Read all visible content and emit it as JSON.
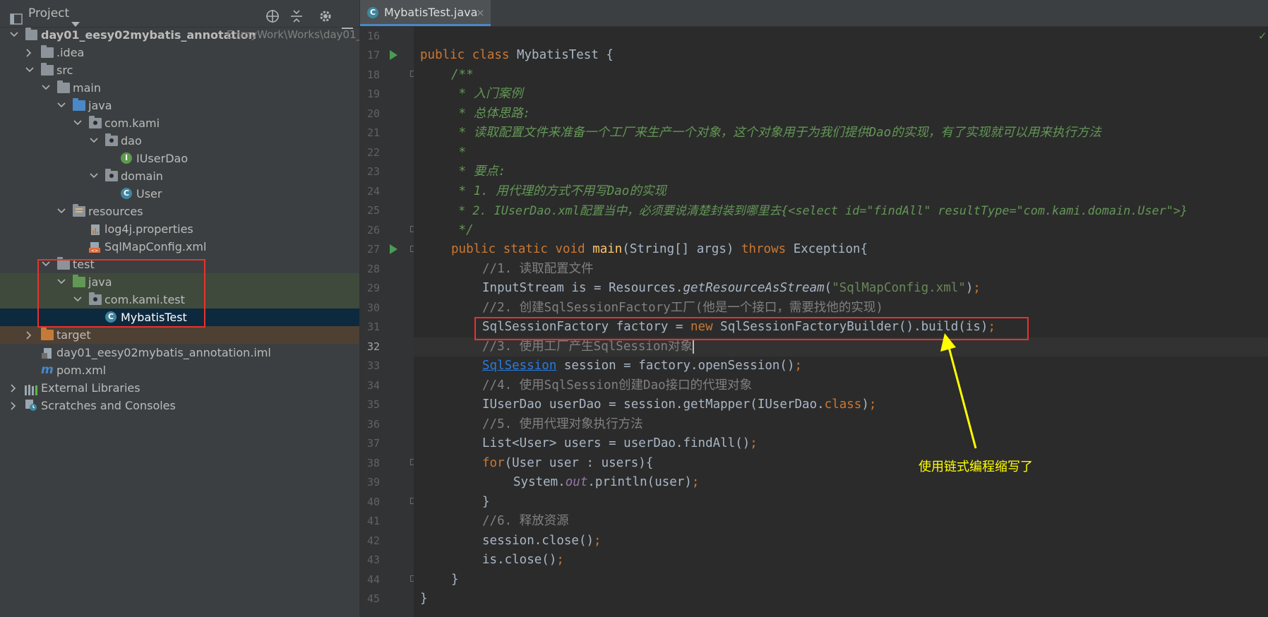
{
  "project_panel": {
    "title": "Project",
    "tree": [
      {
        "label": "day01_eesy02mybatis_annotation",
        "path": "E:\\myWork\\Works\\day01_"
      },
      {
        "label": ".idea"
      },
      {
        "label": "src"
      },
      {
        "label": "main"
      },
      {
        "label": "java"
      },
      {
        "label": "com.kami"
      },
      {
        "label": "dao"
      },
      {
        "label": "IUserDao"
      },
      {
        "label": "domain"
      },
      {
        "label": "User"
      },
      {
        "label": "resources"
      },
      {
        "label": "log4j.properties"
      },
      {
        "label": "SqlMapConfig.xml"
      },
      {
        "label": "test"
      },
      {
        "label": "java"
      },
      {
        "label": "com.kami.test"
      },
      {
        "label": "MybatisTest"
      },
      {
        "label": "target"
      },
      {
        "label": "day01_eesy02mybatis_annotation.iml"
      },
      {
        "label": "pom.xml"
      },
      {
        "label": "External Libraries"
      },
      {
        "label": "Scratches and Consoles"
      }
    ]
  },
  "editor": {
    "tab": {
      "label": "MybatisTest.java",
      "close": "×"
    },
    "line_numbers": [
      "16",
      "17",
      "18",
      "19",
      "20",
      "21",
      "22",
      "23",
      "24",
      "25",
      "26",
      "27",
      "28",
      "29",
      "30",
      "31",
      "32",
      "33",
      "34",
      "35",
      "36",
      "37",
      "38",
      "39",
      "40",
      "41",
      "42",
      "43",
      "44",
      "45"
    ],
    "code": {
      "l17": {
        "kw1": "public",
        "kw2": "class",
        "rest": " MybatisTest {"
      },
      "l18": "/**",
      "l19": " * 入门案例",
      "l20": " * 总体思路:",
      "l21": " * 读取配置文件来准备一个工厂来生产一个对象，这个对象用于为我们提供Dao的实现，有了实现就可以用来执行方法",
      "l22": " *",
      "l23": " * 要点:",
      "l24": " * 1. 用代理的方式不用写Dao的实现",
      "l25": " * 2. IUserDao.xml配置当中，必须要说清楚封装到哪里去{<select id=\"findAll\" resultType=\"com.kami.domain.User\">}",
      "l26": " */",
      "l27": {
        "kw": "public static void",
        "fn": "main",
        "mid": "(String[] args) ",
        "kw2": "throws",
        "rest": " Exception{"
      },
      "l28": "//1. 读取配置文件",
      "l29": {
        "a": "InputStream is = Resources.",
        "m": "getResourceAsStream",
        "b": "(",
        "s": "\"SqlMapConfig.xml\"",
        "c": ")",
        "semi": ";"
      },
      "l30": "//2. 创建SqlSessionFactory工厂(他是一个接口，需要找他的实现)",
      "l31": {
        "a": "SqlSessionFactory factory = ",
        "kw": "new",
        "b": " SqlSessionFactoryBuilder().build(is)",
        "semi": ";"
      },
      "l32": "//3. 使用工厂产生SqlSession对象",
      "l33": {
        "link": "SqlSession",
        "b": " session = factory.openSession()",
        "semi": ";"
      },
      "l34": "//4. 使用SqlSession创建Dao接口的代理对象",
      "l35": {
        "a": "IUserDao userDao = session.getMapper(IUserDao.",
        "kw": "class",
        "b": ")",
        "semi": ";"
      },
      "l36": "//5. 使用代理对象执行方法",
      "l37": {
        "a": "List<User> users = userDao.findAll()",
        "semi": ";"
      },
      "l38": {
        "kw": "for",
        "b": "(User user : users){"
      },
      "l39": {
        "a": "System.",
        "f": "out",
        "b": ".println(user)",
        "semi": ";"
      },
      "l40": "}",
      "l41": "//6. 释放资源",
      "l42": {
        "a": "session.close()",
        "semi": ";"
      },
      "l43": {
        "a": "is.close()",
        "semi": ";"
      },
      "l44": "}",
      "l45": "}"
    }
  },
  "annotation": {
    "text": "使用链式编程缩写了",
    "color": "#ffff00",
    "box_color": "#e8322c"
  }
}
